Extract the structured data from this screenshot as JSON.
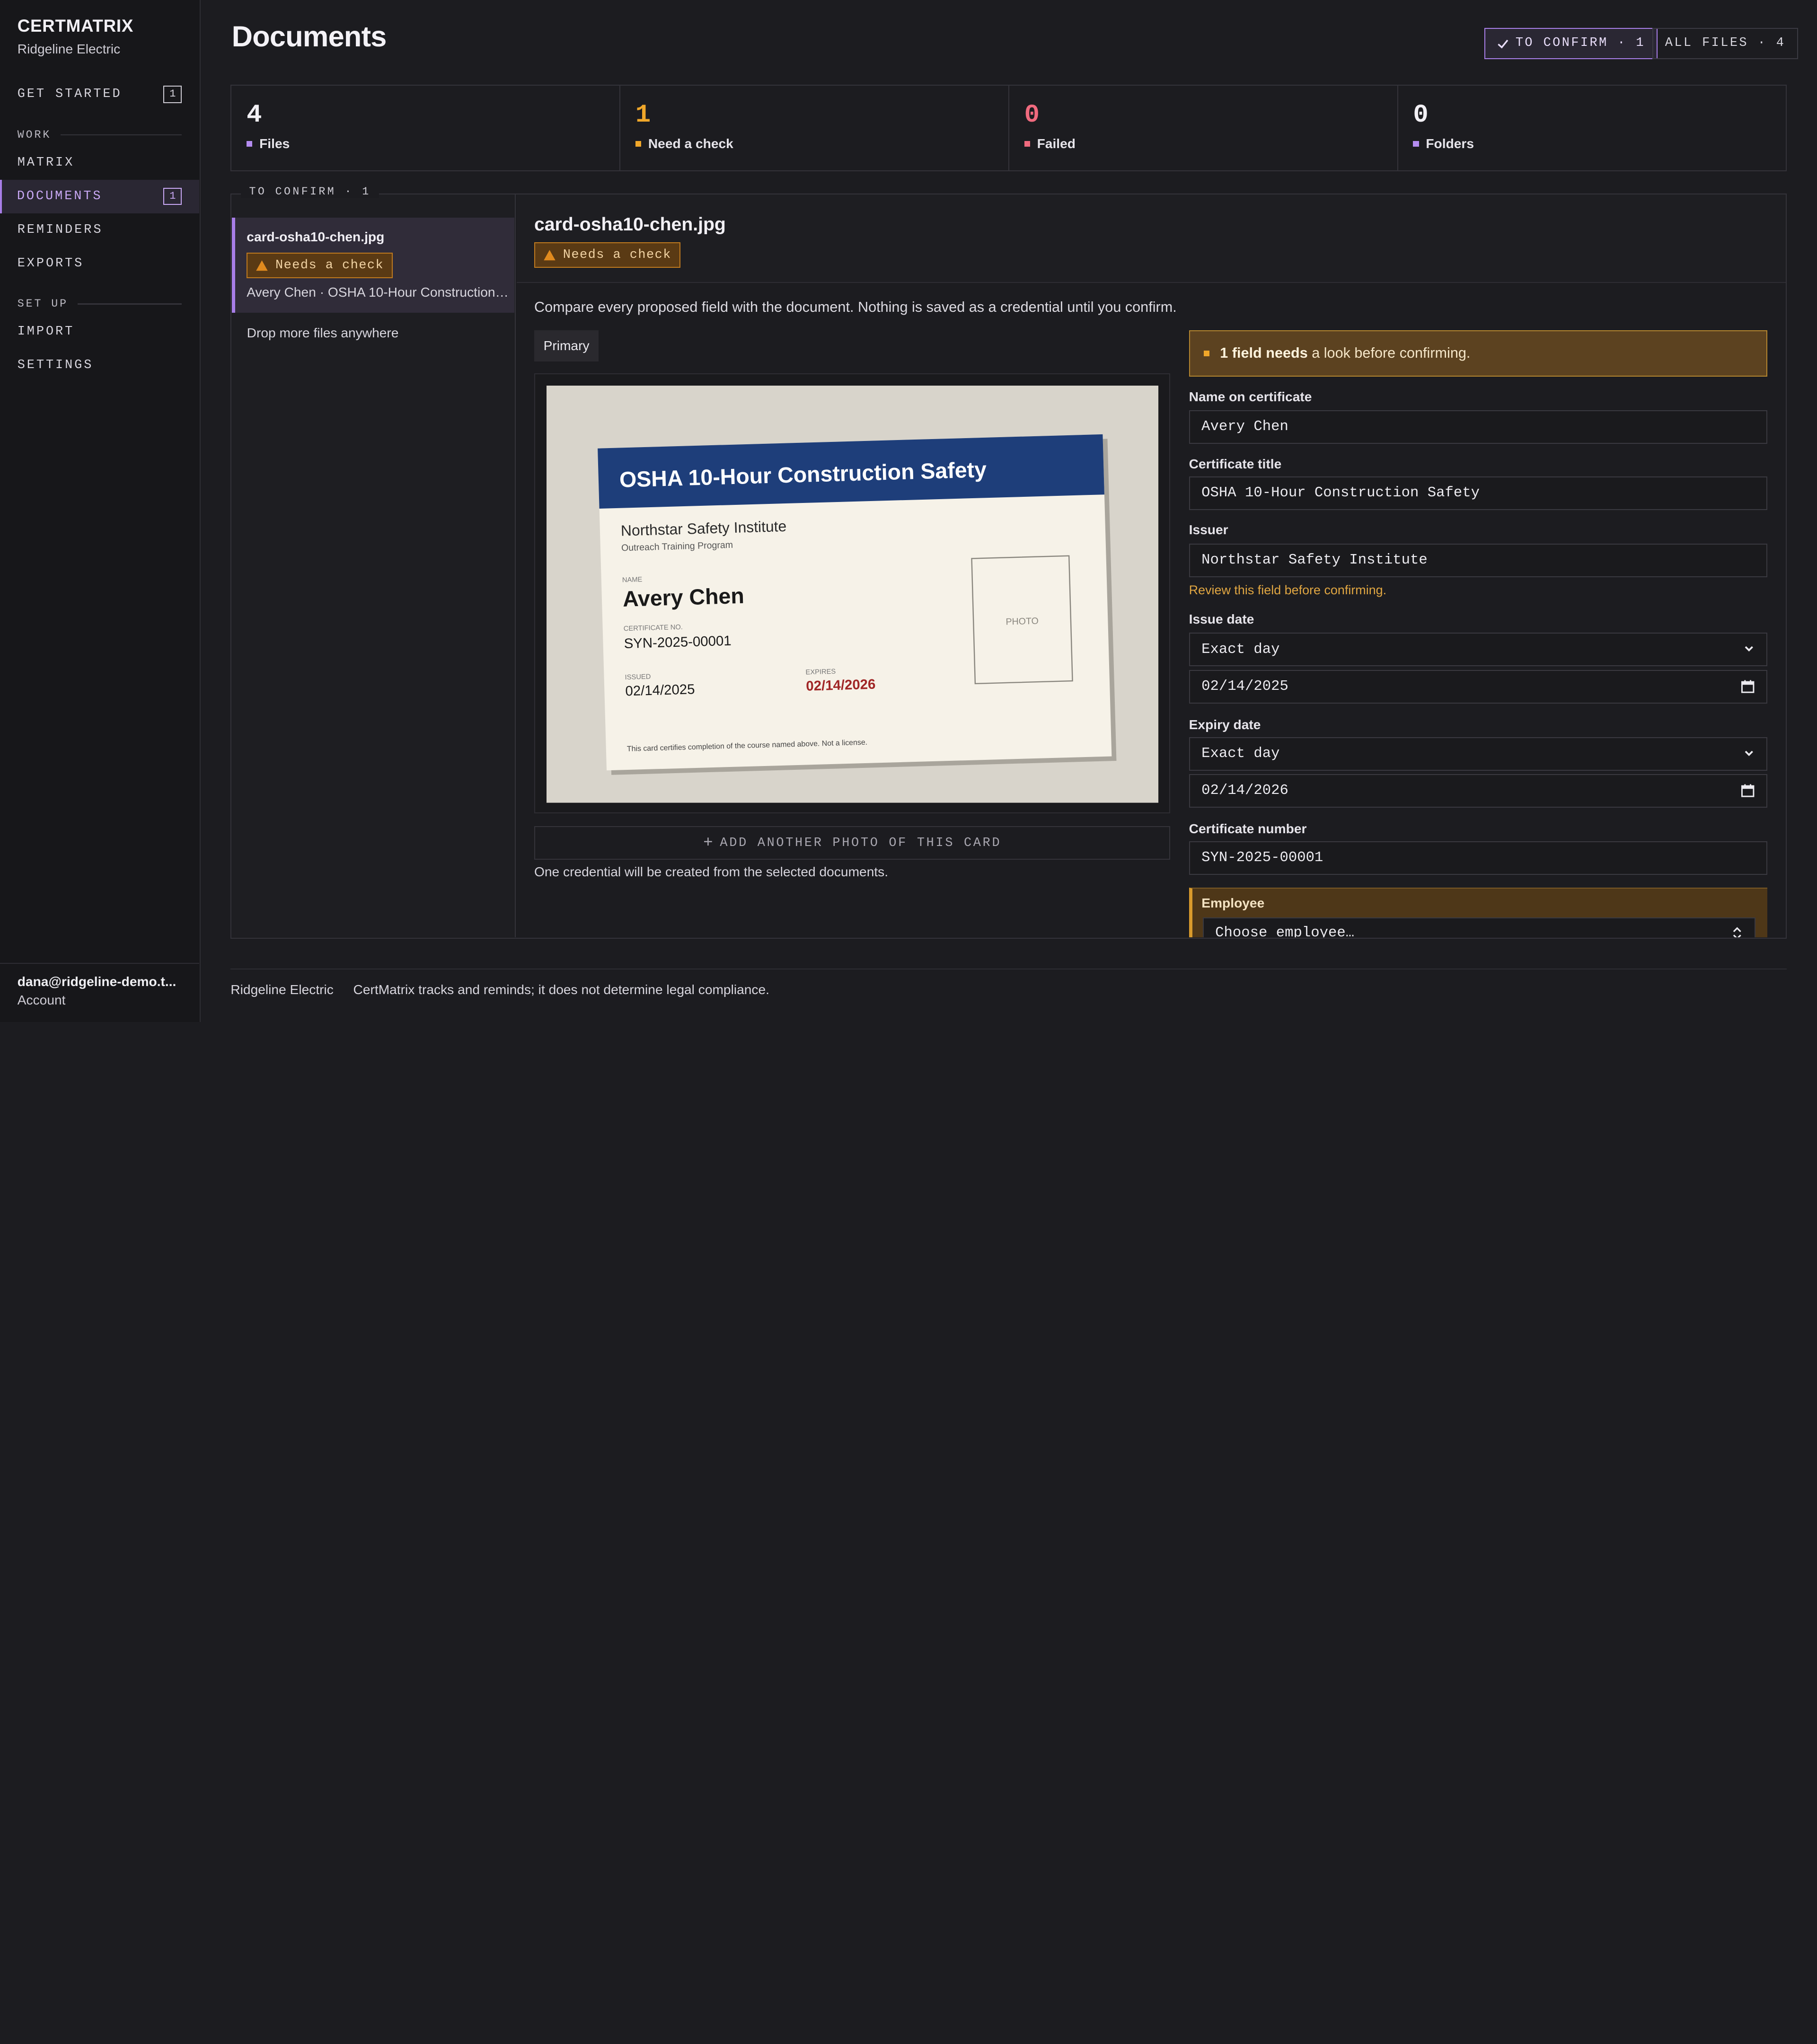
{
  "sidebar": {
    "brand": "CERTMATRIX",
    "org": "Ridgeline Electric",
    "get_started": {
      "label": "GET STARTED",
      "badge": "1"
    },
    "work_section": "WORK",
    "items": [
      {
        "label": "MATRIX"
      },
      {
        "label": "DOCUMENTS",
        "badge": "1"
      },
      {
        "label": "REMINDERS"
      },
      {
        "label": "EXPORTS"
      }
    ],
    "setup_section": "SET UP",
    "setup_items": [
      {
        "label": "IMPORT"
      },
      {
        "label": "SETTINGS"
      }
    ],
    "account_email": "dana@ridgeline-demo.t...",
    "account_label": "Account"
  },
  "header": {
    "title": "Documents",
    "filter_confirm": "TO CONFIRM · 1",
    "filter_all": "ALL FILES · 4"
  },
  "stats": [
    {
      "value": "4",
      "label": "Files",
      "color": "#b48cf0"
    },
    {
      "value": "1",
      "label": "Need a check",
      "color": "#f0a72a"
    },
    {
      "value": "0",
      "label": "Failed",
      "color": "#f06a7e"
    },
    {
      "value": "0",
      "label": "Folders",
      "color": "#b48cf0"
    }
  ],
  "queue": {
    "legend": "TO CONFIRM · 1",
    "item": {
      "filename": "card-osha10-chen.jpg",
      "badge": "Needs a check",
      "summary": "Avery Chen · OSHA 10-Hour Construction Safety"
    },
    "drop_hint": "Drop more files anywhere"
  },
  "detail": {
    "filename": "card-osha10-chen.jpg",
    "badge": "Needs a check",
    "intro": "Compare every proposed field with the document. Nothing is saved as a credential until you confirm.",
    "tab": "Primary",
    "add_photo": "ADD ANOTHER PHOTO OF THIS CARD",
    "note": "One credential will be created from the selected documents.",
    "card": {
      "title": "OSHA 10-Hour Construction Safety",
      "institute": "Northstar Safety Institute",
      "program": "Outreach Training Program",
      "name_label": "NAME",
      "name": "Avery Chen",
      "certno_label": "CERTIFICATE NO.",
      "certno": "SYN-2025-00001",
      "issued_label": "ISSUED",
      "issued": "02/14/2025",
      "expires_label": "EXPIRES",
      "expires": "02/14/2026",
      "photo_label": "PHOTO",
      "disclaimer": "This card certifies completion of the course named above. Not a license."
    },
    "alert_strong": "1 field needs",
    "alert_rest": " a look before confirming.",
    "fields": {
      "name_label": "Name on certificate",
      "name_value": "Avery Chen",
      "title_label": "Certificate title",
      "title_value": "OSHA 10-Hour Construction Safety",
      "issuer_label": "Issuer",
      "issuer_value": "Northstar Safety Institute",
      "issuer_hint": "Review this field before confirming.",
      "issue_label": "Issue date",
      "issue_mode": "Exact day",
      "issue_value": "02/14/2025",
      "expiry_label": "Expiry date",
      "expiry_mode": "Exact day",
      "expiry_value": "02/14/2026",
      "certno_label": "Certificate number",
      "certno_value": "SYN-2025-00001",
      "employee_label": "Employee",
      "employee_placeholder": "Choose employee…"
    }
  },
  "footer": {
    "org": "Ridgeline Electric",
    "disclaimer": "CertMatrix tracks and reminds; it does not determine legal compliance."
  }
}
